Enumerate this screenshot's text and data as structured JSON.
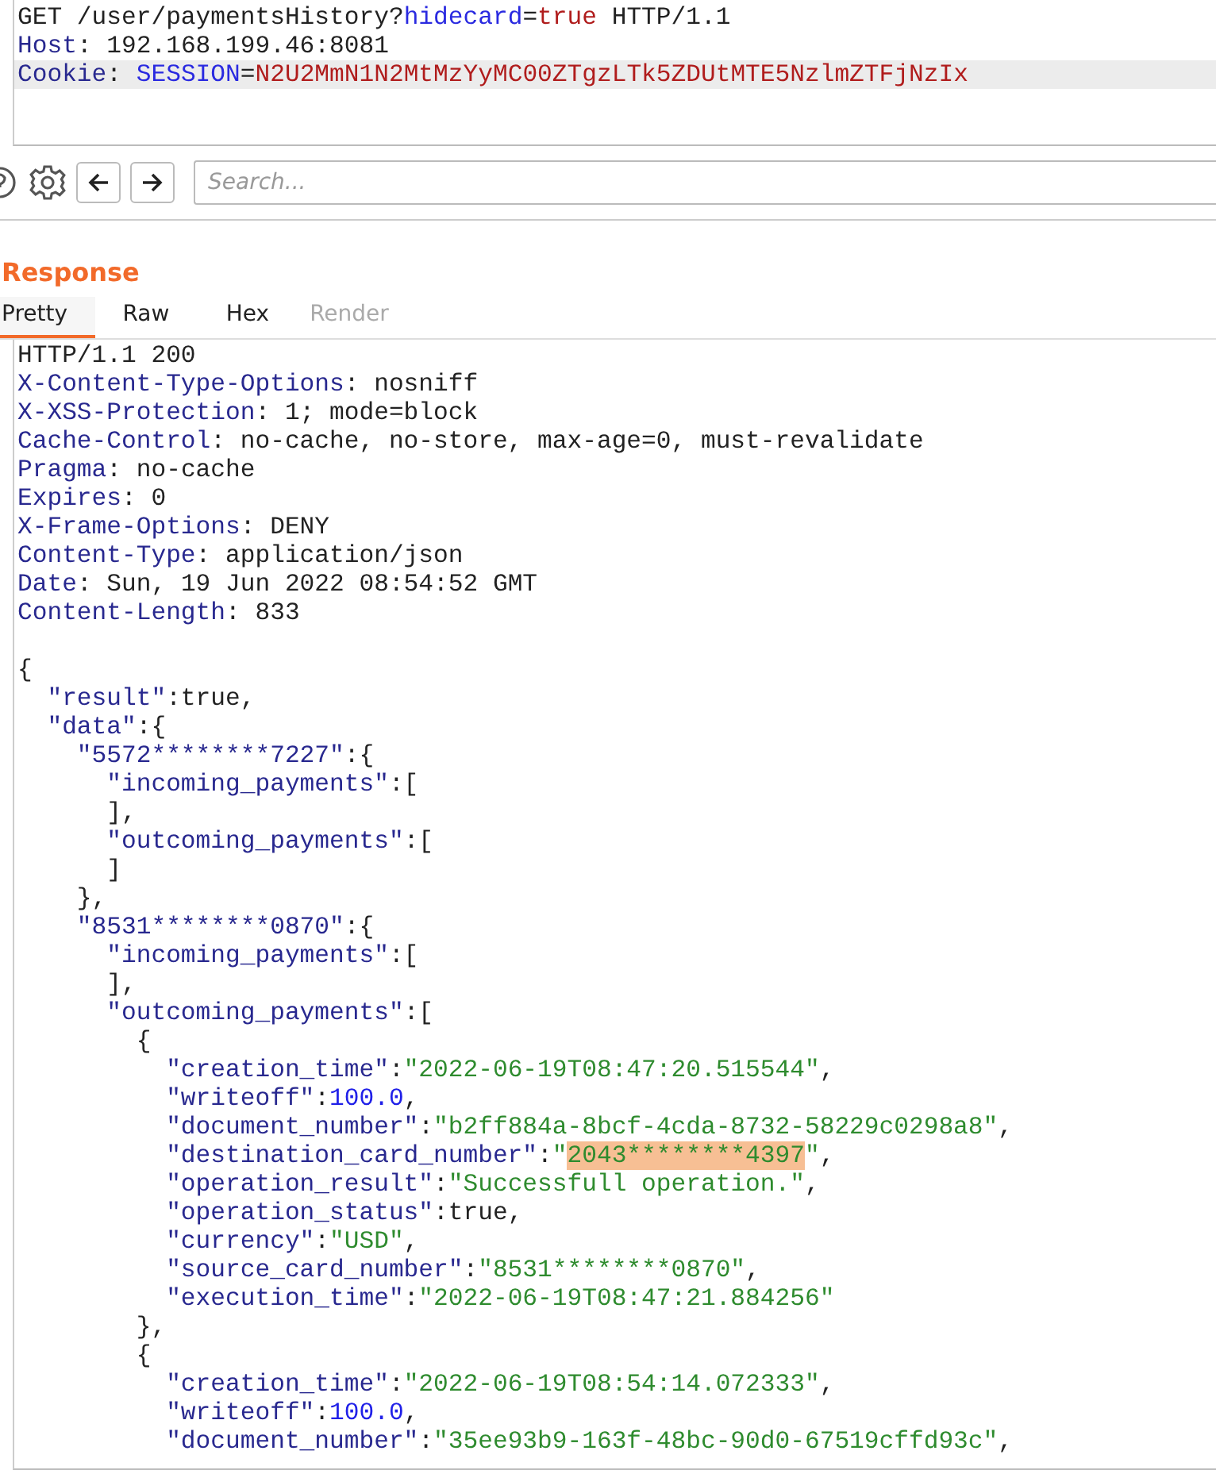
{
  "request": {
    "lines": [
      {
        "highlighted": false,
        "tokens": [
          {
            "kind": "plain",
            "t": "GET /user/paymentsHistory?"
          },
          {
            "kind": "name",
            "t": "hidecard"
          },
          {
            "kind": "plain",
            "t": "="
          },
          {
            "kind": "value",
            "t": "true"
          },
          {
            "kind": "plain",
            "t": " HTTP/1.1"
          }
        ]
      },
      {
        "highlighted": false,
        "tokens": [
          {
            "kind": "key",
            "t": "Host"
          },
          {
            "kind": "plain",
            "t": ": 192.168.199.46:8081"
          }
        ]
      },
      {
        "highlighted": true,
        "tokens": [
          {
            "kind": "key",
            "t": "Cookie"
          },
          {
            "kind": "plain",
            "t": ": "
          },
          {
            "kind": "name",
            "t": "SESSION"
          },
          {
            "kind": "plain",
            "t": "="
          },
          {
            "kind": "value",
            "t": "N2U2MmN1N2MtMzYyMC00ZTgzLTk5ZDUtMTE5NzlmZTFjNzIx"
          }
        ]
      }
    ]
  },
  "toolbar": {
    "search": {
      "placeholder": "Search..."
    }
  },
  "response": {
    "title": "Response",
    "tabs": [
      {
        "label": "Pretty",
        "selected": true,
        "disabled": false
      },
      {
        "label": "Raw",
        "selected": false,
        "disabled": false
      },
      {
        "label": "Hex",
        "selected": false,
        "disabled": false
      },
      {
        "label": "Render",
        "selected": false,
        "disabled": true
      }
    ],
    "headers": [
      {
        "tokens": [
          {
            "kind": "plain",
            "t": "HTTP/1.1 200"
          }
        ]
      },
      {
        "tokens": [
          {
            "kind": "key",
            "t": "X-Content-Type-Options"
          },
          {
            "kind": "plain",
            "t": ": nosniff"
          }
        ]
      },
      {
        "tokens": [
          {
            "kind": "key",
            "t": "X-XSS-Protection"
          },
          {
            "kind": "plain",
            "t": ": 1; mode=block"
          }
        ]
      },
      {
        "tokens": [
          {
            "kind": "key",
            "t": "Cache-Control"
          },
          {
            "kind": "plain",
            "t": ": no-cache, no-store, max-age=0, must-revalidate"
          }
        ]
      },
      {
        "tokens": [
          {
            "kind": "key",
            "t": "Pragma"
          },
          {
            "kind": "plain",
            "t": ": no-cache"
          }
        ]
      },
      {
        "tokens": [
          {
            "kind": "key",
            "t": "Expires"
          },
          {
            "kind": "plain",
            "t": ": 0"
          }
        ]
      },
      {
        "tokens": [
          {
            "kind": "key",
            "t": "X-Frame-Options"
          },
          {
            "kind": "plain",
            "t": ": DENY"
          }
        ]
      },
      {
        "tokens": [
          {
            "kind": "key",
            "t": "Content-Type"
          },
          {
            "kind": "plain",
            "t": ": application/json"
          }
        ]
      },
      {
        "tokens": [
          {
            "kind": "key",
            "t": "Date"
          },
          {
            "kind": "plain",
            "t": ": Sun, 19 Jun 2022 08:54:52 GMT"
          }
        ]
      },
      {
        "tokens": [
          {
            "kind": "key",
            "t": "Content-Length"
          },
          {
            "kind": "plain",
            "t": ": 833"
          }
        ]
      }
    ],
    "body": [
      {
        "tokens": [
          {
            "kind": "plain",
            "t": "{"
          }
        ]
      },
      {
        "tokens": [
          {
            "kind": "key",
            "t": "  \"result\""
          },
          {
            "kind": "plain",
            "t": ":true,"
          }
        ]
      },
      {
        "tokens": [
          {
            "kind": "key",
            "t": "  \"data\""
          },
          {
            "kind": "plain",
            "t": ":{"
          }
        ]
      },
      {
        "tokens": [
          {
            "kind": "key",
            "t": "    \"5572********7227\""
          },
          {
            "kind": "plain",
            "t": ":{"
          }
        ]
      },
      {
        "tokens": [
          {
            "kind": "key",
            "t": "      \"incoming_payments\""
          },
          {
            "kind": "plain",
            "t": ":["
          }
        ]
      },
      {
        "tokens": [
          {
            "kind": "plain",
            "t": "      ],"
          }
        ]
      },
      {
        "tokens": [
          {
            "kind": "key",
            "t": "      \"outcoming_payments\""
          },
          {
            "kind": "plain",
            "t": ":["
          }
        ]
      },
      {
        "tokens": [
          {
            "kind": "plain",
            "t": "      ]"
          }
        ]
      },
      {
        "tokens": [
          {
            "kind": "plain",
            "t": "    },"
          }
        ]
      },
      {
        "tokens": [
          {
            "kind": "key",
            "t": "    \"8531********0870\""
          },
          {
            "kind": "plain",
            "t": ":{"
          }
        ]
      },
      {
        "tokens": [
          {
            "kind": "key",
            "t": "      \"incoming_payments\""
          },
          {
            "kind": "plain",
            "t": ":["
          }
        ]
      },
      {
        "tokens": [
          {
            "kind": "plain",
            "t": "      ],"
          }
        ]
      },
      {
        "tokens": [
          {
            "kind": "key",
            "t": "      \"outcoming_payments\""
          },
          {
            "kind": "plain",
            "t": ":["
          }
        ]
      },
      {
        "tokens": [
          {
            "kind": "plain",
            "t": "        {"
          }
        ]
      },
      {
        "tokens": [
          {
            "kind": "key",
            "t": "          \"creation_time\""
          },
          {
            "kind": "plain",
            "t": ":"
          },
          {
            "kind": "string",
            "t": "\"2022-06-19T08:47:20.515544\""
          },
          {
            "kind": "plain",
            "t": ","
          }
        ]
      },
      {
        "tokens": [
          {
            "kind": "key",
            "t": "          \"writeoff\""
          },
          {
            "kind": "plain",
            "t": ":"
          },
          {
            "kind": "number",
            "t": "100.0"
          },
          {
            "kind": "plain",
            "t": ","
          }
        ]
      },
      {
        "tokens": [
          {
            "kind": "key",
            "t": "          \"document_number\""
          },
          {
            "kind": "plain",
            "t": ":"
          },
          {
            "kind": "string",
            "t": "\"b2ff884a-8bcf-4cda-8732-58229c0298a8\""
          },
          {
            "kind": "plain",
            "t": ","
          }
        ]
      },
      {
        "tokens": [
          {
            "kind": "key",
            "t": "          \"destination_card_number\""
          },
          {
            "kind": "plain",
            "t": ":"
          },
          {
            "kind": "string",
            "t": "\""
          },
          {
            "kind": "match",
            "t": "2043********4397"
          },
          {
            "kind": "string",
            "t": "\""
          },
          {
            "kind": "plain",
            "t": ","
          }
        ]
      },
      {
        "tokens": [
          {
            "kind": "key",
            "t": "          \"operation_result\""
          },
          {
            "kind": "plain",
            "t": ":"
          },
          {
            "kind": "string",
            "t": "\"Successfull operation.\""
          },
          {
            "kind": "plain",
            "t": ","
          }
        ]
      },
      {
        "tokens": [
          {
            "kind": "key",
            "t": "          \"operation_status\""
          },
          {
            "kind": "plain",
            "t": ":true,"
          }
        ]
      },
      {
        "tokens": [
          {
            "kind": "key",
            "t": "          \"currency\""
          },
          {
            "kind": "plain",
            "t": ":"
          },
          {
            "kind": "string",
            "t": "\"USD\""
          },
          {
            "kind": "plain",
            "t": ","
          }
        ]
      },
      {
        "tokens": [
          {
            "kind": "key",
            "t": "          \"source_card_number\""
          },
          {
            "kind": "plain",
            "t": ":"
          },
          {
            "kind": "string",
            "t": "\"8531********0870\""
          },
          {
            "kind": "plain",
            "t": ","
          }
        ]
      },
      {
        "tokens": [
          {
            "kind": "key",
            "t": "          \"execution_time\""
          },
          {
            "kind": "plain",
            "t": ":"
          },
          {
            "kind": "string",
            "t": "\"2022-06-19T08:47:21.884256\""
          }
        ]
      },
      {
        "tokens": [
          {
            "kind": "plain",
            "t": "        },"
          }
        ]
      },
      {
        "tokens": [
          {
            "kind": "plain",
            "t": "        {"
          }
        ]
      },
      {
        "tokens": [
          {
            "kind": "key",
            "t": "          \"creation_time\""
          },
          {
            "kind": "plain",
            "t": ":"
          },
          {
            "kind": "string",
            "t": "\"2022-06-19T08:54:14.072333\""
          },
          {
            "kind": "plain",
            "t": ","
          }
        ]
      },
      {
        "tokens": [
          {
            "kind": "key",
            "t": "          \"writeoff\""
          },
          {
            "kind": "plain",
            "t": ":"
          },
          {
            "kind": "number",
            "t": "100.0"
          },
          {
            "kind": "plain",
            "t": ","
          }
        ]
      },
      {
        "tokens": [
          {
            "kind": "key",
            "t": "          \"document_number\""
          },
          {
            "kind": "plain",
            "t": ":"
          },
          {
            "kind": "string",
            "t": "\"35ee93b9-163f-48bc-90d0-67519cffd93c\""
          },
          {
            "kind": "plain",
            "t": ","
          }
        ]
      }
    ]
  }
}
